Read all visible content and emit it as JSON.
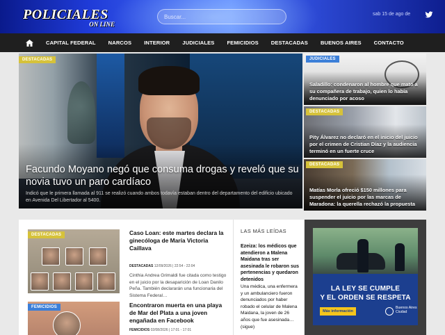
{
  "header": {
    "logo_text": "POLICIALES",
    "logo_sub": "ON LINE",
    "search_placeholder": "Buscar...",
    "date": "sab 15 de ago de",
    "social_icon": "twitter-icon"
  },
  "nav": {
    "home_icon": "home-icon",
    "items": [
      "CAPITAL FEDERAL",
      "NARCOS",
      "INTERIOR",
      "JUDICIALES",
      "FEMICIDIOS",
      "DESTACADAS",
      "BUENOS AIRES",
      "CONTACTO"
    ]
  },
  "hero": {
    "badge": "DESTACADAS",
    "title": "Facundo Moyano negó que consuma drogas y reveló que su novia tuvo un paro cardíaco",
    "subtitle": "Indicó que le primera llamada al 911 se realizó cuando ambos todavía estaban dentro del departamento del edificio ubicado en Avenida Del Libertador al 5400."
  },
  "side": [
    {
      "badge": "JUDICIALES",
      "title": "Saladillo: condenaron al hombre que mató a su compañera de trabajo, quien lo había denunciado por acoso"
    },
    {
      "badge": "DESTACADAS",
      "title": "Pity Álvarez no declaró en el inicio del juicio por el crimen de Cristian Díaz y la audiencia terminó en un fuerte cruce"
    },
    {
      "badge": "DESTACADAS",
      "title": "Matías Morla ofreció $150 millones para suspender el juicio por las marcas de Maradona: la querella rechazó la propuesta"
    }
  ],
  "news": [
    {
      "badge": "DESTACADAS",
      "title": "Caso Loan: este martes declara la ginecóloga de María Victoria Caillava",
      "meta_cat": "DESTACADAS",
      "meta_date": "12/09/2026 | 22:54 - 22:04",
      "body": "Cinthia Andrea Grimaldi fue citada como testigo en el juicio por la desaparición de Loan Danilo Peña. También declararán una funcionaria del Sistema Federal…"
    },
    {
      "badge": "FEMICIDIOS",
      "title": "Encontraron muerta en una playa de Mar del Plata a una joven engañada en Facebook",
      "meta_cat": "FEMICIDIOS",
      "meta_date": "02/08/2026 | 17:01 - 17:01",
      "body": ""
    }
  ],
  "mas_leidas": {
    "heading": "LAS MÁS LEÍDAS",
    "title": "Ezeiza: los médicos que atendieron a Malena Maidana tras ser asesinada le robaron sus pertenencias y quedaron detenidos",
    "body": "Una médica, una enfermera y un ambulanciero fueron denunciados por haber robado el celular de Malena Maidana, la joven de 26 años que fue asesinada…",
    "more": "(sigue)"
  },
  "ad": {
    "line1": "LA LEY SE CUMPLE",
    "line2": "Y EL ORDEN SE RESPETA",
    "button": "Más información",
    "brand": "Buenos Aires Ciudad"
  },
  "colors": {
    "badge_yellow": "#d6c23a",
    "badge_blue": "#3c7fd8",
    "nav_bg": "#1f1f1f",
    "ad_blue": "#1c3f8f"
  }
}
